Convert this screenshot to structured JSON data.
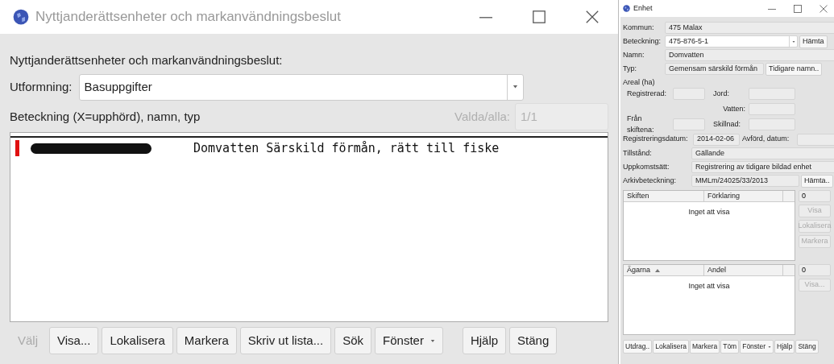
{
  "main_window": {
    "title": "Nyttjanderättsenheter och markanvändningsbeslut",
    "heading": "Nyttjanderättsenheter och markanvändningsbeslut:",
    "layout": {
      "label": "Utformning:",
      "value": "Basuppgifter"
    },
    "list_label": "Beteckning (X=upphörd), namn, typ",
    "count": {
      "label": "Valda/alla:",
      "value": "1/1",
      "disabled": true
    },
    "rows": [
      {
        "text": "Domvatten Särskild förmån, rätt till fiske",
        "redacted": true,
        "selected": true
      }
    ],
    "buttons": [
      {
        "label": "Välj",
        "kind": "button",
        "disabled": true
      },
      {
        "label": "Visa...",
        "kind": "button",
        "disabled": false
      },
      {
        "label": "Lokalisera",
        "kind": "button",
        "disabled": false
      },
      {
        "label": "Markera",
        "kind": "button",
        "disabled": false
      },
      {
        "label": "Skriv ut lista...",
        "kind": "button",
        "disabled": false
      },
      {
        "label": "Sök",
        "kind": "button",
        "disabled": false
      },
      {
        "label": "Fönster",
        "kind": "dropdown",
        "disabled": false
      }
    ],
    "end_buttons": [
      {
        "label": "Hjälp",
        "kind": "button",
        "disabled": false
      },
      {
        "label": "Stäng",
        "kind": "button",
        "disabled": false
      }
    ]
  },
  "unit_window": {
    "title": "Enhet",
    "fields": [
      {
        "label": "Kommun:",
        "value": "475 Malax",
        "kind": "text"
      },
      {
        "label": "Beteckning:",
        "value": "475-876-5-1",
        "kind": "combo",
        "button": "Hämta"
      },
      {
        "label": "Namn:",
        "value": "Domvatten",
        "kind": "text"
      },
      {
        "label": "Typ:",
        "value": "Gemensam särskild förmån",
        "kind": "text",
        "button": "Tidigare namn.."
      }
    ],
    "area": {
      "title": "Areal (ha)",
      "registered": "Registrerad:",
      "soil": "Jord:",
      "water": "Vatten:",
      "from_parcels": "Från skiftena:",
      "difference": "Skillnad:"
    },
    "dates": {
      "registered_label": "Registreringsdatum:",
      "registered_value": "2014-02-06",
      "removed_label": "Avförd, datum:"
    },
    "fields2": [
      {
        "label": "Tillstånd:",
        "value": "Gällande",
        "kind": "text"
      },
      {
        "label": "Uppkomstsätt:",
        "value": "Registrering av tidigare bildad enhet",
        "kind": "text"
      },
      {
        "label": "Arkivbeteckning:",
        "value": "MMLm/24025/33/2013",
        "kind": "text",
        "button": "Hämta.."
      }
    ],
    "tables": [
      {
        "columns": [
          {
            "label": "Skiften",
            "sorted_ascending": false
          },
          {
            "label": "Förklaring",
            "sorted_ascending": false
          }
        ],
        "empty": "Inget att visa",
        "count": "0",
        "buttons": [
          {
            "label": "Visa",
            "disabled": true
          },
          {
            "label": "Lokalisera",
            "disabled": true
          },
          {
            "label": "Markera",
            "disabled": true
          }
        ]
      },
      {
        "columns": [
          {
            "label": "Ägarna",
            "sorted_ascending": true
          },
          {
            "label": "Andel",
            "sorted_ascending": false
          }
        ],
        "empty": "Inget att visa",
        "count": "0",
        "buttons": [
          {
            "label": "Visa...",
            "disabled": true
          }
        ]
      }
    ],
    "buttons": [
      {
        "label": "Utdrag..",
        "kind": "button"
      },
      {
        "label": "Lokalisera",
        "kind": "button"
      },
      {
        "label": "Markera",
        "kind": "button"
      },
      {
        "label": "Töm",
        "kind": "button"
      },
      {
        "label": "Fönster",
        "kind": "dropdown"
      },
      {
        "label": "Hjälp",
        "kind": "button"
      },
      {
        "label": "Stäng",
        "kind": "button"
      }
    ]
  }
}
